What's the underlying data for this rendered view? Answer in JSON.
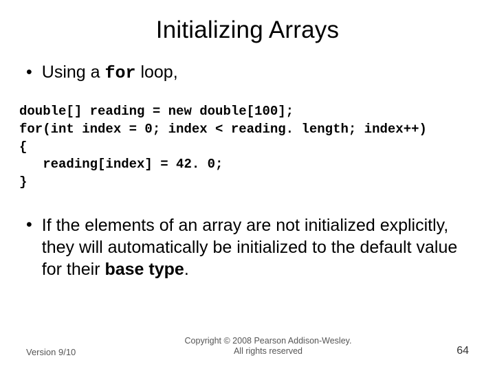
{
  "title": "Initializing Arrays",
  "bullet1": {
    "prefix": "Using a ",
    "code": "for",
    "suffix": " loop,"
  },
  "code": {
    "l1": "double[] reading = new double[100];",
    "l2": "for(int index = 0; index < reading. length; index++)",
    "l3": "{",
    "l4": "   reading[index] = 42. 0;",
    "l5": "}"
  },
  "bullet2": {
    "part1": "If the elements of an array are not initialized explicitly, they will automatically be initialized to the default value for their ",
    "bold": "base type",
    "part2": "."
  },
  "footer": {
    "version": "Version 9/10",
    "copyright_l1": "Copyright © 2008 Pearson Addison-Wesley.",
    "copyright_l2": "All rights reserved",
    "page": "64"
  }
}
